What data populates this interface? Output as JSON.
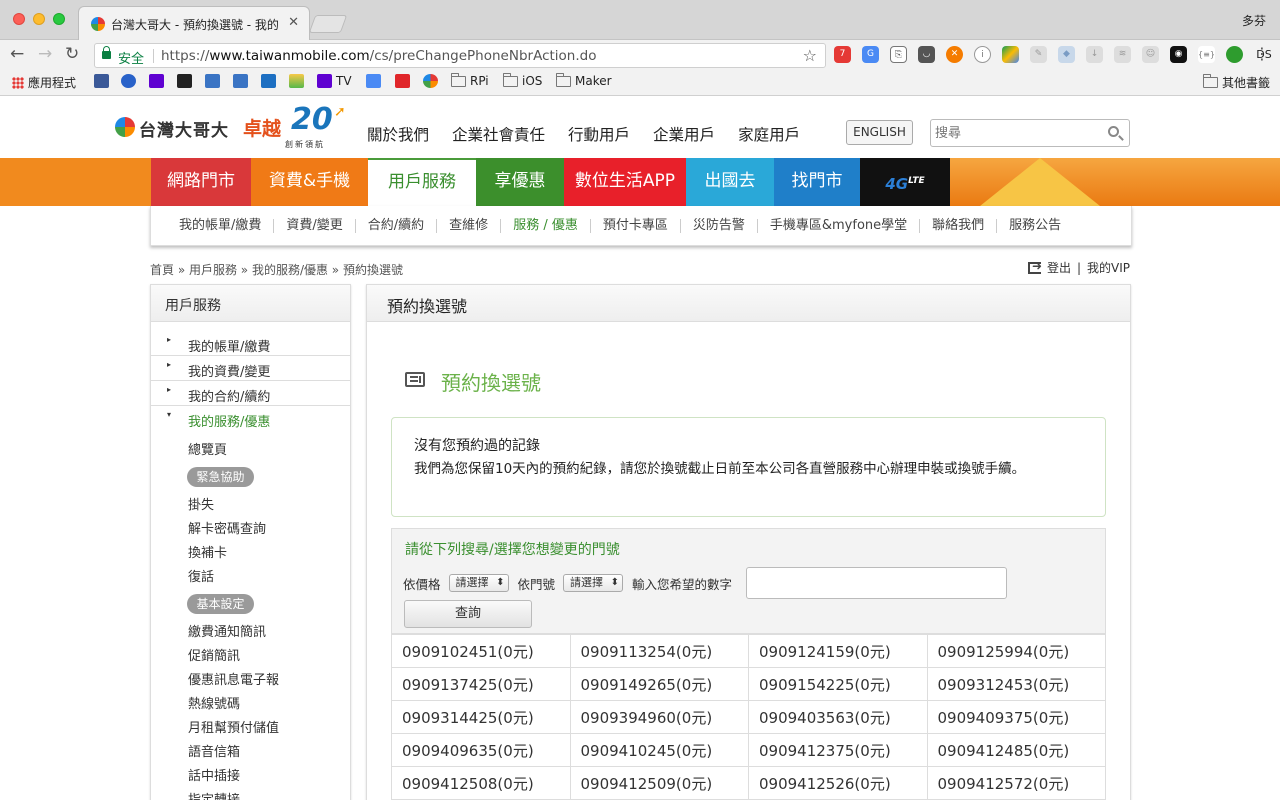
{
  "browser": {
    "tab_title": "台灣大哥大 - 預約換選號 - 我的",
    "profile_name": "多芬",
    "secure_label": "安全",
    "url_prefix": "https://",
    "url_domain": "www.taiwanmobile.com",
    "url_path": "/cs/preChangePhoneNbrAction.do",
    "ext_ds_label": "DS",
    "bookmarks": [
      {
        "label": "應用程式",
        "icon": "apps-icon"
      },
      {
        "label": "",
        "icon": "facebook-icon"
      },
      {
        "label": "",
        "icon": "chat-icon"
      },
      {
        "label": "",
        "icon": "yahoo-icon"
      },
      {
        "label": "",
        "icon": "bbc-icon"
      },
      {
        "label": "",
        "icon": "mail-icon"
      },
      {
        "label": "",
        "icon": "mail-icon"
      },
      {
        "label": "",
        "icon": "seven-icon"
      },
      {
        "label": "",
        "icon": "w-icon"
      },
      {
        "label": "TV",
        "icon": "yahoo-icon"
      },
      {
        "label": "",
        "icon": "translate-icon"
      },
      {
        "label": "",
        "icon": "red-icon"
      },
      {
        "label": "",
        "icon": "color-ball-icon"
      },
      {
        "label": "RPi",
        "icon": "folder-icon"
      },
      {
        "label": "iOS",
        "icon": "folder-icon"
      },
      {
        "label": "Maker",
        "icon": "folder-icon"
      }
    ],
    "other_bookmarks": "其他書籤"
  },
  "header": {
    "logo_text": "台灣大哥大",
    "logo_slogan": "卓越",
    "logo_number": "20",
    "logo_sub": "創新領航",
    "nav": [
      "關於我們",
      "企業社會責任",
      "行動用戶",
      "企業用戶",
      "家庭用戶"
    ],
    "english_label": "ENGLISH",
    "search_placeholder": "搜尋"
  },
  "categories": {
    "items": [
      "網路門市",
      "資費&手機",
      "用戶服務",
      "享優惠",
      "數位生活APP",
      "出國去",
      "找門市"
    ],
    "lte": "4G",
    "lte_sup": "LTE",
    "colors": [
      "#d9383a",
      "#f07a16",
      "#ffffff",
      "#3c8f2c",
      "#e8202a",
      "#2aa8d8",
      "#1f7fc9",
      "#111111"
    ]
  },
  "subnav": [
    "我的帳單/繳費",
    "資費/變更",
    "合約/續約",
    "查維修",
    "服務 / 優惠",
    "預付卡專區",
    "災防告警",
    "手機專區&myfone學堂",
    "聯絡我們",
    "服務公告"
  ],
  "breadcrumb": "首頁 » 用戶服務 » 我的服務/優惠 » 預約換選號",
  "account": {
    "logout": "登出",
    "vip": "我的VIP"
  },
  "sidebar": {
    "title": "用戶服務",
    "items": [
      "我的帳單/繳費",
      "我的資費/變更",
      "我的合約/續約",
      "我的服務/優惠"
    ],
    "sub_top": "總覽頁",
    "group1": {
      "badge": "緊急協助",
      "items": [
        "掛失",
        "解卡密碼查詢",
        "換補卡",
        "復話"
      ]
    },
    "group2": {
      "badge": "基本設定",
      "items": [
        "繳費通知簡訊",
        "促銷簡訊",
        "優惠訊息電子報",
        "熱線號碼",
        "月租幫預付儲值",
        "語音信箱",
        "話中插接",
        "指定轉接"
      ]
    }
  },
  "main": {
    "header_title": "預約換選號",
    "page_title": "預約換選號",
    "notice_title": "沒有您預約過的記錄",
    "notice_body": "我們為您保留10天內的預約紀錄，請您於換號截止日前至本公司各直營服務中心辦理申裝或換號手續。",
    "search_title": "請從下列搜尋/選擇您想變更的門號",
    "price_label": "依價格",
    "price_select": "請選擇",
    "number_label": "依門號",
    "number_select": "請選擇",
    "digits_label": "輸入您希望的數字",
    "query_button": "查詢",
    "numbers": [
      [
        "0909102451(0元)",
        "0909113254(0元)",
        "0909124159(0元)",
        "0909125994(0元)"
      ],
      [
        "0909137425(0元)",
        "0909149265(0元)",
        "0909154225(0元)",
        "0909312453(0元)"
      ],
      [
        "0909314425(0元)",
        "0909394960(0元)",
        "0909403563(0元)",
        "0909409375(0元)"
      ],
      [
        "0909409635(0元)",
        "0909410245(0元)",
        "0909412375(0元)",
        "0909412485(0元)"
      ],
      [
        "0909412508(0元)",
        "0909412509(0元)",
        "0909412526(0元)",
        "0909412572(0元)"
      ]
    ]
  }
}
